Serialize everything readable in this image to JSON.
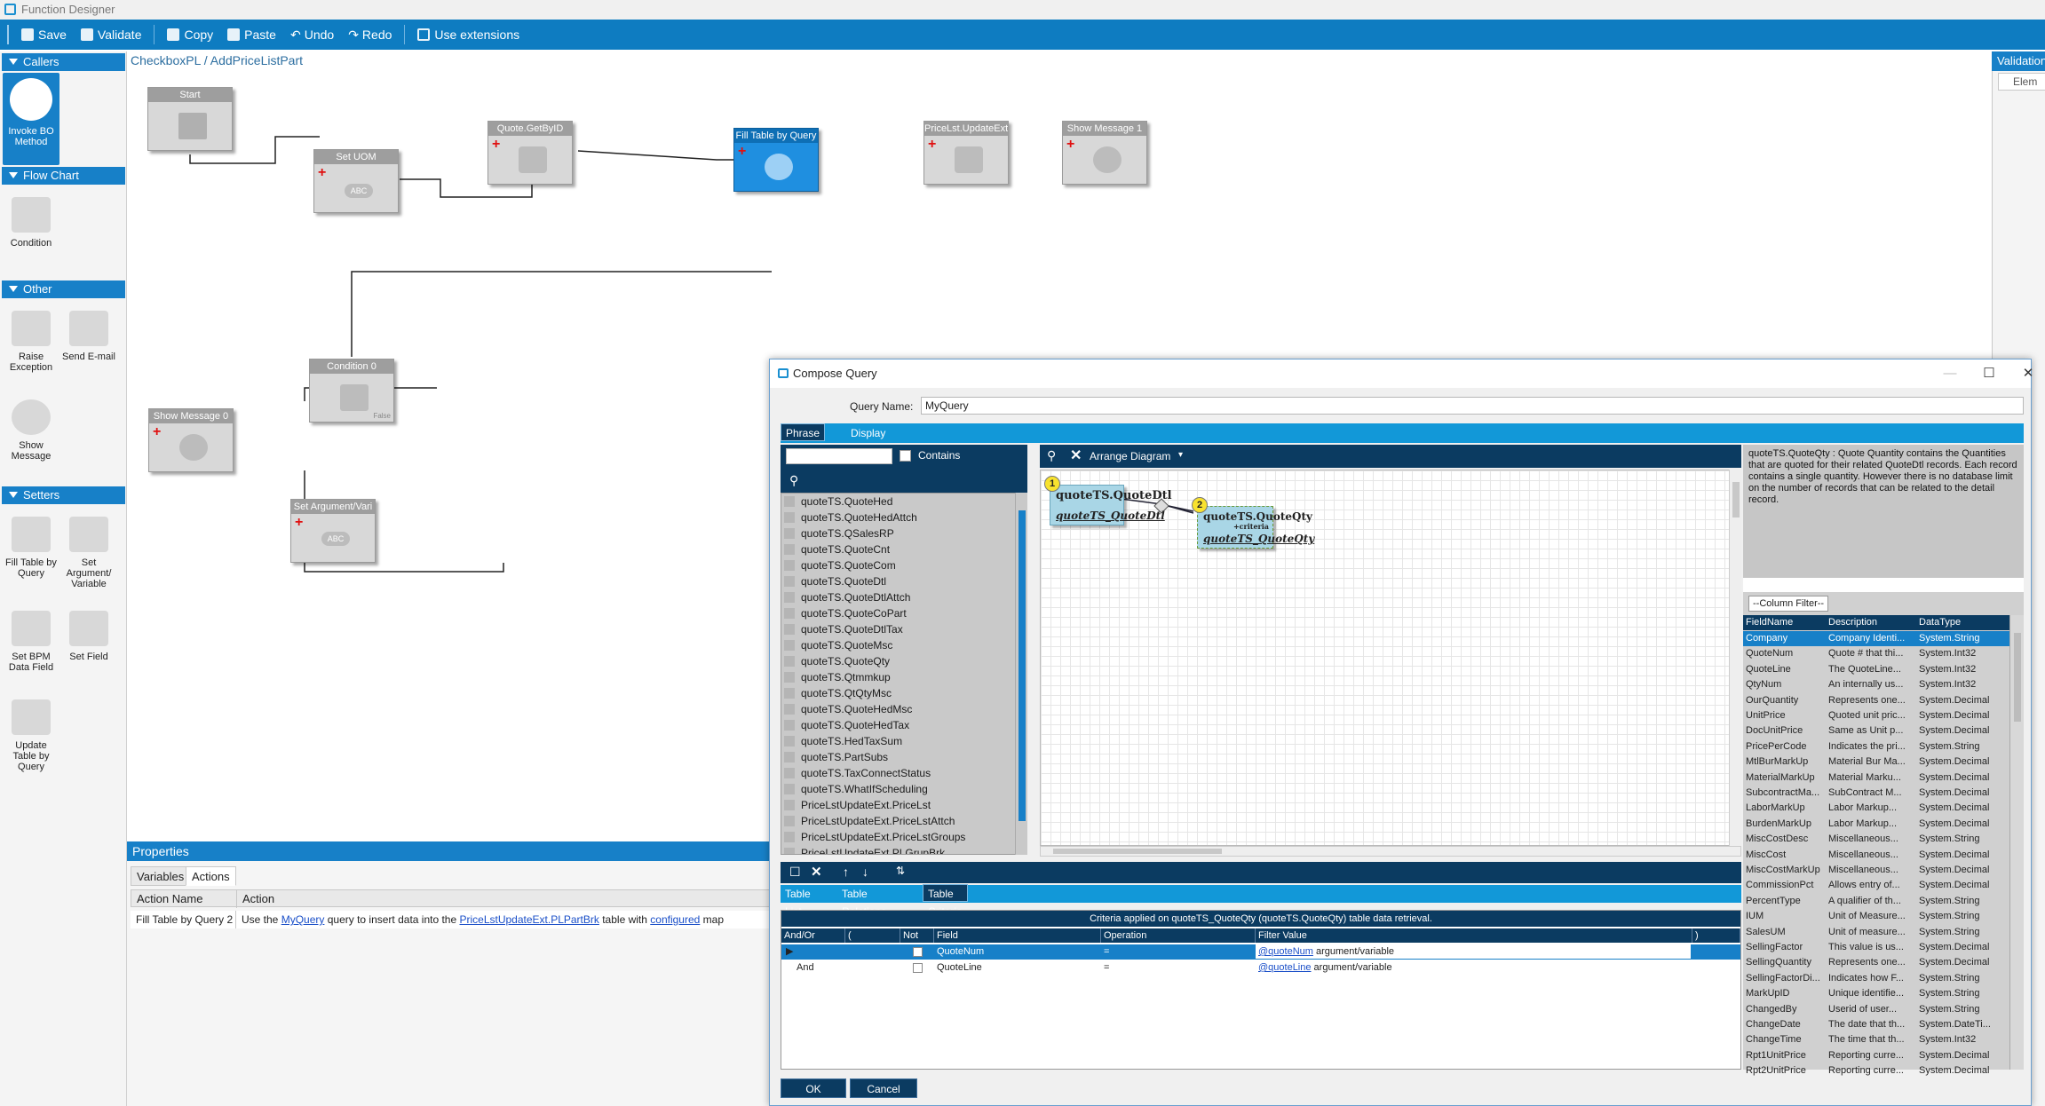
{
  "app": {
    "title": "Function Designer"
  },
  "toolbar": {
    "save": "Save",
    "validate": "Validate",
    "copy": "Copy",
    "paste": "Paste",
    "undo": "Undo",
    "redo": "Redo",
    "use_extensions": "Use extensions"
  },
  "palette": {
    "callers": {
      "title": "Callers",
      "items": [
        "Invoke BO Method"
      ]
    },
    "flowchart": {
      "title": "Flow Chart",
      "items": [
        "Condition"
      ]
    },
    "other": {
      "title": "Other",
      "items": [
        "Raise Exception",
        "Send E-mail",
        "Show Message"
      ]
    },
    "setters": {
      "title": "Setters",
      "items": [
        "Fill Table by Query",
        "Set Argument/ Variable",
        "Set BPM Data Field",
        "Set Field",
        "Update Table by Query"
      ]
    }
  },
  "breadcrumb": "CheckboxPL / AddPriceListPart",
  "workflow": {
    "nodes": [
      "Start",
      "Set UOM",
      "Quote.GetByID",
      "Fill Table by Query",
      "PriceLst.UpdateExt",
      "Show Message 1",
      "Condition 0",
      "Show Message 0",
      "Set Argument/Vari"
    ],
    "node_icon_text": "ABC",
    "condition_false": "False"
  },
  "properties": {
    "title": "Properties",
    "tabs": [
      "Variables",
      "Actions"
    ],
    "active_tab": "Actions",
    "columns": [
      "Action Name",
      "Action"
    ],
    "row": {
      "name": "Fill Table by Query 2",
      "action_pre": "Use the ",
      "query_link": "MyQuery",
      "action_mid": " query to insert data into the ",
      "table_link": "PriceLstUpdateExt.PLPartBrk",
      "action_mid2": " table with ",
      "config_link": "configured",
      "action_post": " map"
    }
  },
  "validation": {
    "title": "Validation",
    "col": "Elem"
  },
  "dialog": {
    "title": "Compose Query",
    "query_name_label": "Query Name:",
    "query_name": "MyQuery",
    "tabs": [
      "Phrase Build",
      "Display Fields"
    ],
    "contains_label": "Contains",
    "arrange_label": "Arrange Diagram",
    "tables": [
      "quoteTS.QuoteHed",
      "quoteTS.QuoteHedAttch",
      "quoteTS.QSalesRP",
      "quoteTS.QuoteCnt",
      "quoteTS.QuoteCom",
      "quoteTS.QuoteDtl",
      "quoteTS.QuoteDtlAttch",
      "quoteTS.QuoteCoPart",
      "quoteTS.QuoteDtlTax",
      "quoteTS.QuoteMsc",
      "quoteTS.QuoteQty",
      "quoteTS.Qtmmkup",
      "quoteTS.QtQtyMsc",
      "quoteTS.QuoteHedMsc",
      "quoteTS.QuoteHedTax",
      "quoteTS.HedTaxSum",
      "quoteTS.PartSubs",
      "quoteTS.TaxConnectStatus",
      "quoteTS.WhatIfScheduling",
      "PriceLstUpdateExt.PriceLst",
      "PriceLstUpdateExt.PriceLstAttch",
      "PriceLstUpdateExt.PriceLstGroups",
      "PriceLstUpdateExt.PLGrupBrk"
    ],
    "diagram": {
      "table1": {
        "badge": "1",
        "name": "quoteTS.QuoteDtl",
        "alias": "quoteTS_QuoteDtl"
      },
      "table2": {
        "badge": "2",
        "name": "quoteTS.QuoteQty",
        "criteria": "+criteria",
        "alias": "quoteTS_QuoteQty"
      }
    },
    "help_text": "quoteTS.QuoteQty : Quote Quantity contains the Quantities that are quoted for their related QuoteDtl records. Each record contains a single quantity. However there is no database limit on the number of records that can be related to the detail record.",
    "column_filter": "--Column Filter--",
    "columns_header": [
      "FieldName",
      "Description",
      "DataType"
    ],
    "columns": [
      [
        "Company",
        "Company Identi...",
        "System.String"
      ],
      [
        "QuoteNum",
        "Quote # that thi...",
        "System.Int32"
      ],
      [
        "QuoteLine",
        "The QuoteLine...",
        "System.Int32"
      ],
      [
        "QtyNum",
        "An internally us...",
        "System.Int32"
      ],
      [
        "OurQuantity",
        "Represents one...",
        "System.Decimal"
      ],
      [
        "UnitPrice",
        "Quoted unit pric...",
        "System.Decimal"
      ],
      [
        "DocUnitPrice",
        "Same as Unit p...",
        "System.Decimal"
      ],
      [
        "PricePerCode",
        "Indicates the pri...",
        "System.String"
      ],
      [
        "MtlBurMarkUp",
        "Material Bur Ma...",
        "System.Decimal"
      ],
      [
        "MaterialMarkUp",
        "Material Marku...",
        "System.Decimal"
      ],
      [
        "SubcontractMa...",
        "SubContract M...",
        "System.Decimal"
      ],
      [
        "LaborMarkUp",
        "Labor Markup...",
        "System.Decimal"
      ],
      [
        "BurdenMarkUp",
        "Labor Markup...",
        "System.Decimal"
      ],
      [
        "MiscCostDesc",
        "Miscellaneous...",
        "System.String"
      ],
      [
        "MiscCost",
        "Miscellaneous...",
        "System.Decimal"
      ],
      [
        "MiscCostMarkUp",
        "Miscellaneous...",
        "System.Decimal"
      ],
      [
        "CommissionPct",
        "Allows entry of...",
        "System.Decimal"
      ],
      [
        "PercentType",
        "A qualifier of th...",
        "System.String"
      ],
      [
        "IUM",
        "Unit of Measure...",
        "System.String"
      ],
      [
        "SalesUM",
        "Unit of measure...",
        "System.String"
      ],
      [
        "SellingFactor",
        "This value is us...",
        "System.Decimal"
      ],
      [
        "SellingQuantity",
        "Represents one...",
        "System.Decimal"
      ],
      [
        "SellingFactorDi...",
        "Indicates how F...",
        "System.String"
      ],
      [
        "MarkUpID",
        "Unique identifie...",
        "System.String"
      ],
      [
        "ChangedBy",
        "Userid of user...",
        "System.String"
      ],
      [
        "ChangeDate",
        "The date that th...",
        "System.DateTi..."
      ],
      [
        "ChangeTime",
        "The time that th...",
        "System.Int32"
      ],
      [
        "Rpt1UnitPrice",
        "Reporting curre...",
        "System.Decimal"
      ],
      [
        "Rpt2UnitPrice",
        "Reporting curre...",
        "System.Decimal"
      ]
    ],
    "bottom_tabs": [
      "Table List",
      "Table Relations",
      "Table Criteria"
    ],
    "criteria_caption": "Criteria applied on quoteTS_QuoteQty (quoteTS.QuoteQty)  table data retrieval.",
    "grid_headers": [
      "And/Or",
      "(",
      "Not",
      "Field",
      "Operation",
      "Filter Value",
      ")"
    ],
    "grid_rows": [
      {
        "andor": "",
        "field": "QuoteNum",
        "op": "=",
        "value_link": "@quoteNum",
        "value_suffix": " argument/variable"
      },
      {
        "andor": "And",
        "field": "QuoteLine",
        "op": "=",
        "value_link": "@quoteLine",
        "value_suffix": " argument/variable"
      }
    ],
    "ok": "OK",
    "cancel": "Cancel"
  },
  "colors": {
    "accent": "#0e7cc1",
    "dark": "#0b3b61",
    "selection": "#1f8fe0"
  }
}
